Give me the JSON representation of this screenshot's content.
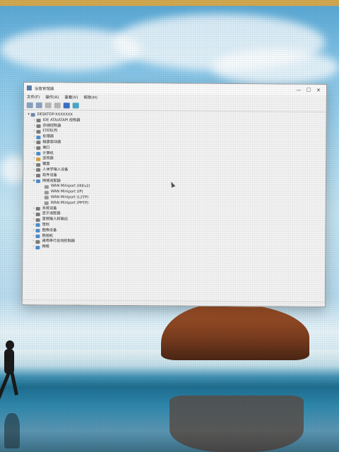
{
  "window": {
    "title": "设备管理器",
    "controls": [
      "—",
      "☐",
      "✕"
    ]
  },
  "menu": [
    "文件(F)",
    "操作(A)",
    "查看(V)",
    "帮助(H)"
  ],
  "toolbar": [
    "back-icon",
    "forward-icon",
    "properties-icon",
    "refresh-icon",
    "help-icon",
    "monitor-icon"
  ],
  "tree": [
    {
      "level": 0,
      "exp": "▾",
      "icon": "#6e8bb0",
      "label": "DESKTOP-XXXXXXX"
    },
    {
      "level": 1,
      "exp": "›",
      "icon": "#7d7d7d",
      "label": "IDE ATA/ATAPI 控制器"
    },
    {
      "level": 1,
      "exp": "›",
      "icon": "#7d7d7d",
      "label": "存储控制器"
    },
    {
      "level": 1,
      "exp": "›",
      "icon": "#7d7d7d",
      "label": "打印队列"
    },
    {
      "level": 1,
      "exp": "›",
      "icon": "#4a8fd0",
      "label": "处理器"
    },
    {
      "level": 1,
      "exp": "›",
      "icon": "#7d7d7d",
      "label": "磁盘驱动器"
    },
    {
      "level": 1,
      "exp": "›",
      "icon": "#7d7d7d",
      "label": "端口"
    },
    {
      "level": 1,
      "exp": "›",
      "icon": "#4a8fd0",
      "label": "计算机"
    },
    {
      "level": 1,
      "exp": "›",
      "icon": "#d8a036",
      "label": "监视器"
    },
    {
      "level": 1,
      "exp": "›",
      "icon": "#7d7d7d",
      "label": "键盘"
    },
    {
      "level": 1,
      "exp": "›",
      "icon": "#7d7d7d",
      "label": "人体学输入设备"
    },
    {
      "level": 1,
      "exp": "›",
      "icon": "#7d7d7d",
      "label": "软件设备"
    },
    {
      "level": 1,
      "exp": "▾",
      "icon": "#4a8fd0",
      "label": "网络适配器"
    },
    {
      "level": 2,
      "exp": "",
      "icon": "#9a9a9a",
      "label": "WAN Miniport (IKEv2)"
    },
    {
      "level": 2,
      "exp": "",
      "icon": "#9a9a9a",
      "label": "WAN Miniport (IP)"
    },
    {
      "level": 2,
      "exp": "",
      "icon": "#9a9a9a",
      "label": "WAN Miniport (L2TP)"
    },
    {
      "level": 2,
      "exp": "",
      "icon": "#9a9a9a",
      "label": "WAN Miniport (PPTP)"
    },
    {
      "level": 1,
      "exp": "›",
      "icon": "#7d7d7d",
      "label": "系统设备"
    },
    {
      "level": 1,
      "exp": "›",
      "icon": "#7d7d7d",
      "label": "显示适配器"
    },
    {
      "level": 1,
      "exp": "›",
      "icon": "#7d7d7d",
      "label": "音频输入和输出"
    },
    {
      "level": 1,
      "exp": "›",
      "icon": "#4a8fd0",
      "label": "鼠标"
    },
    {
      "level": 1,
      "exp": "›",
      "icon": "#4a8fd0",
      "label": "图像设备"
    },
    {
      "level": 1,
      "exp": "›",
      "icon": "#4a8fd0",
      "label": "照相机"
    },
    {
      "level": 1,
      "exp": "›",
      "icon": "#7d7d7d",
      "label": "通用串行总线控制器"
    },
    {
      "level": 1,
      "exp": "›",
      "icon": "#4a8fd0",
      "label": "网络"
    }
  ]
}
